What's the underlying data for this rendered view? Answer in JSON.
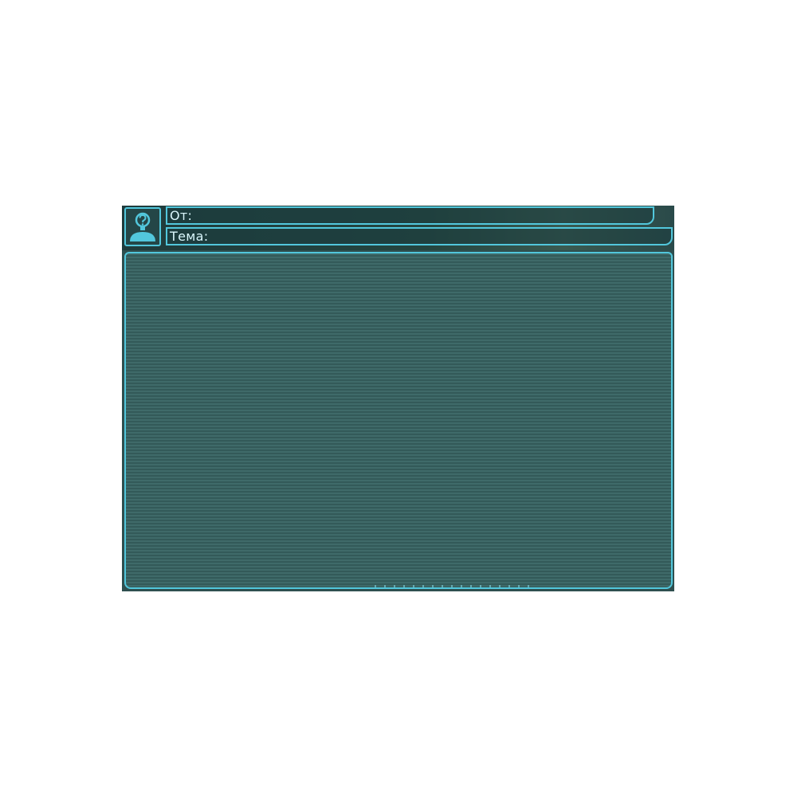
{
  "mail_window": {
    "from_label": "От:",
    "from_value": "",
    "subject_label": "Тема:",
    "subject_value": "",
    "body_text": ""
  },
  "icons": {
    "sender_avatar": "unknown-person-icon"
  },
  "colors": {
    "frame_accent": "#52c7dc",
    "panel_background": "#2f4f4f",
    "label_text": "#d9f6fb"
  }
}
